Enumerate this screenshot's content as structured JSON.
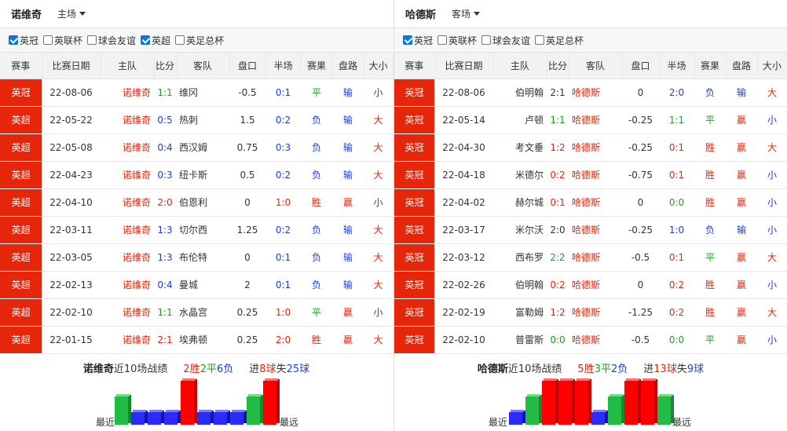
{
  "left": {
    "team": "诺维奇",
    "venue": "主场",
    "filters": [
      {
        "label": "英冠",
        "checked": true
      },
      {
        "label": "英联杯",
        "checked": false
      },
      {
        "label": "球会友谊",
        "checked": false
      },
      {
        "label": "英超",
        "checked": true
      },
      {
        "label": "英足总杯",
        "checked": false
      }
    ],
    "headers": [
      "赛事",
      "比赛日期",
      "主队",
      "比分",
      "客队",
      "盘口",
      "半场",
      "赛果",
      "盘路",
      "大小"
    ],
    "rows": [
      {
        "comp": "英冠",
        "date": "22-08-06",
        "home": "诺维奇",
        "score": "1:1",
        "away": "维冈",
        "handicap": "-0.5",
        "half": "0:1",
        "result": "平",
        "line": "输",
        "ou": "小"
      },
      {
        "comp": "英超",
        "date": "22-05-22",
        "home": "诺维奇",
        "score": "0:5",
        "away": "热刺",
        "handicap": "1.5",
        "half": "0:2",
        "result": "负",
        "line": "输",
        "ou": "大"
      },
      {
        "comp": "英超",
        "date": "22-05-08",
        "home": "诺维奇",
        "score": "0:4",
        "away": "西汉姆",
        "handicap": "0.75",
        "half": "0:3",
        "result": "负",
        "line": "输",
        "ou": "大"
      },
      {
        "comp": "英超",
        "date": "22-04-23",
        "home": "诺维奇",
        "score": "0:3",
        "away": "纽卡斯",
        "handicap": "0.5",
        "half": "0:2",
        "result": "负",
        "line": "输",
        "ou": "大"
      },
      {
        "comp": "英超",
        "date": "22-04-10",
        "home": "诺维奇",
        "score": "2:0",
        "away": "伯恩利",
        "handicap": "0",
        "half": "1:0",
        "result": "胜",
        "line": "赢",
        "ou": "小"
      },
      {
        "comp": "英超",
        "date": "22-03-11",
        "home": "诺维奇",
        "score": "1:3",
        "away": "切尔西",
        "handicap": "1.25",
        "half": "0:2",
        "result": "负",
        "line": "输",
        "ou": "大"
      },
      {
        "comp": "英超",
        "date": "22-03-05",
        "home": "诺维奇",
        "score": "1:3",
        "away": "布伦特",
        "handicap": "0",
        "half": "0:1",
        "result": "负",
        "line": "输",
        "ou": "大"
      },
      {
        "comp": "英超",
        "date": "22-02-13",
        "home": "诺维奇",
        "score": "0:4",
        "away": "曼城",
        "handicap": "2",
        "half": "0:1",
        "result": "负",
        "line": "输",
        "ou": "大"
      },
      {
        "comp": "英超",
        "date": "22-02-10",
        "home": "诺维奇",
        "score": "1:1",
        "away": "水晶宫",
        "handicap": "0.25",
        "half": "1:0",
        "result": "平",
        "line": "赢",
        "ou": "小"
      },
      {
        "comp": "英超",
        "date": "22-01-15",
        "home": "诺维奇",
        "score": "2:1",
        "away": "埃弗顿",
        "handicap": "0.25",
        "half": "2:0",
        "result": "胜",
        "line": "赢",
        "ou": "大"
      }
    ],
    "summary": {
      "team": "诺维奇",
      "text1": "近10场战绩",
      "wins": "2胜",
      "draws": "2平",
      "losses": "6负",
      "goals_label": "进",
      "goals_for": "8球",
      "against_label": "失",
      "goals_against": "25球"
    },
    "form": [
      "draw",
      "loss",
      "loss",
      "loss",
      "win",
      "loss",
      "loss",
      "loss",
      "draw",
      "win"
    ],
    "recent_label": "最近",
    "far_label": "最远"
  },
  "right": {
    "team": "哈德斯",
    "venue": "客场",
    "filters": [
      {
        "label": "英冠",
        "checked": true
      },
      {
        "label": "英联杯",
        "checked": false
      },
      {
        "label": "球会友谊",
        "checked": false
      },
      {
        "label": "英足总杯",
        "checked": false
      }
    ],
    "headers": [
      "赛事",
      "比赛日期",
      "主队",
      "比分",
      "客队",
      "盘口",
      "半场",
      "赛果",
      "盘路",
      "大小"
    ],
    "rows": [
      {
        "comp": "英冠",
        "date": "22-08-06",
        "home": "伯明翰",
        "score": "2:1",
        "away": "哈德斯",
        "handicap": "0",
        "half": "2:0",
        "result": "负",
        "line": "输",
        "ou": "大"
      },
      {
        "comp": "英冠",
        "date": "22-05-14",
        "home": "卢顿",
        "score": "1:1",
        "away": "哈德斯",
        "handicap": "-0.25",
        "half": "1:1",
        "result": "平",
        "line": "赢",
        "ou": "小"
      },
      {
        "comp": "英冠",
        "date": "22-04-30",
        "home": "考文垂",
        "score": "1:2",
        "away": "哈德斯",
        "handicap": "-0.25",
        "half": "0:1",
        "result": "胜",
        "line": "赢",
        "ou": "大"
      },
      {
        "comp": "英冠",
        "date": "22-04-18",
        "home": "米德尔",
        "score": "0:2",
        "away": "哈德斯",
        "handicap": "-0.75",
        "half": "0:1",
        "result": "胜",
        "line": "赢",
        "ou": "小"
      },
      {
        "comp": "英冠",
        "date": "22-04-02",
        "home": "赫尔城",
        "score": "0:1",
        "away": "哈德斯",
        "handicap": "0",
        "half": "0:0",
        "result": "胜",
        "line": "赢",
        "ou": "小"
      },
      {
        "comp": "英冠",
        "date": "22-03-17",
        "home": "米尔沃",
        "score": "2:0",
        "away": "哈德斯",
        "handicap": "-0.25",
        "half": "1:0",
        "result": "负",
        "line": "输",
        "ou": "小"
      },
      {
        "comp": "英冠",
        "date": "22-03-12",
        "home": "西布罗",
        "score": "2:2",
        "away": "哈德斯",
        "handicap": "-0.5",
        "half": "0:1",
        "result": "平",
        "line": "赢",
        "ou": "大"
      },
      {
        "comp": "英冠",
        "date": "22-02-26",
        "home": "伯明翰",
        "score": "0:2",
        "away": "哈德斯",
        "handicap": "0",
        "half": "0:2",
        "result": "胜",
        "line": "赢",
        "ou": "小"
      },
      {
        "comp": "英冠",
        "date": "22-02-19",
        "home": "富勒姆",
        "score": "1:2",
        "away": "哈德斯",
        "handicap": "-1.25",
        "half": "0:2",
        "result": "胜",
        "line": "赢",
        "ou": "大"
      },
      {
        "comp": "英冠",
        "date": "22-02-10",
        "home": "普雷斯",
        "score": "0:0",
        "away": "哈德斯",
        "handicap": "-0.5",
        "half": "0:0",
        "result": "平",
        "line": "赢",
        "ou": "小"
      }
    ],
    "summary": {
      "team": "哈德斯",
      "text1": "近10场战绩",
      "wins": "5胜",
      "draws": "3平",
      "losses": "2负",
      "goals_label": "进",
      "goals_for": "13球",
      "against_label": "失",
      "goals_against": "9球"
    },
    "form": [
      "loss",
      "draw",
      "win",
      "win",
      "win",
      "loss",
      "draw",
      "win",
      "win",
      "draw"
    ],
    "recent_label": "最近",
    "far_label": "最远"
  },
  "colors": {
    "comp_bg": "#e5260b",
    "win": "#ff0000",
    "draw": "#22bb44",
    "loss": "#2b2bff",
    "checkbox": "#0b78d7"
  }
}
